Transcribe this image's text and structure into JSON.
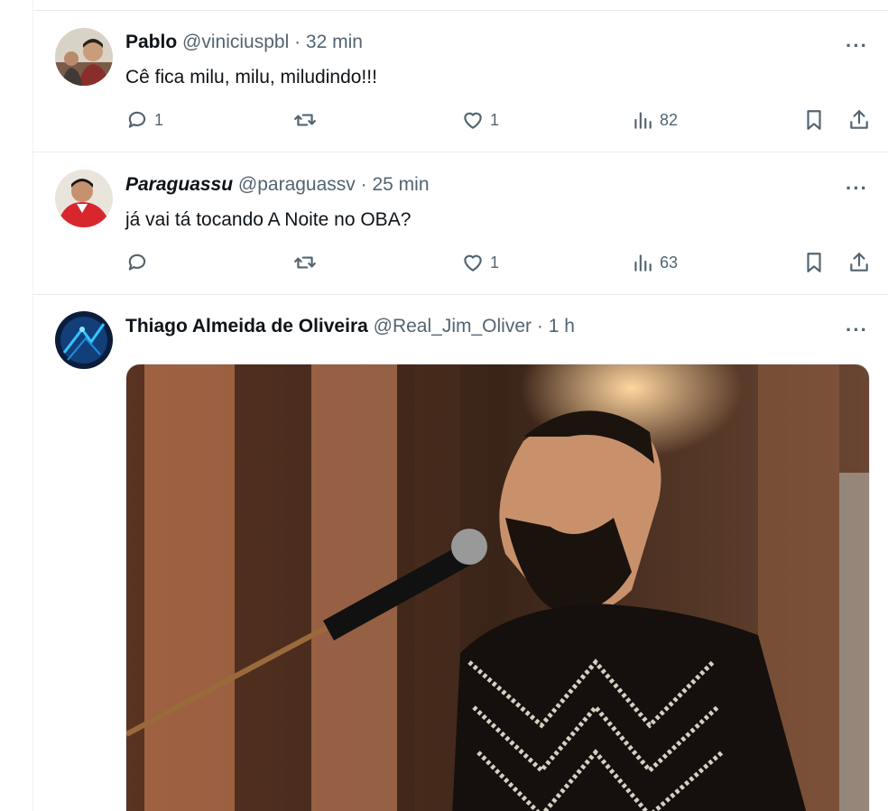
{
  "tweets": [
    {
      "name": "Pablo",
      "handle": "@viniciuspbl",
      "separator": "·",
      "time": "32 min",
      "text": "Cê fica milu, milu, miludindo!!!",
      "more": "···",
      "replies": "1",
      "retweets": "",
      "likes": "1",
      "views": "82"
    },
    {
      "name": "Paraguassu",
      "handle": "@paraguassv",
      "separator": "·",
      "time": "25 min",
      "text": "já vai tá tocando A Noite no OBA?",
      "more": "···",
      "replies": "",
      "retweets": "",
      "likes": "1",
      "views": "63"
    },
    {
      "name": "Thiago Almeida de Oliveira",
      "handle": "@Real_Jim_Oliver",
      "separator": "·",
      "time": "1 h",
      "more": "···"
    }
  ],
  "icons": {
    "reply": "speech-bubble-icon",
    "retweet": "retweet-icon",
    "like": "heart-icon",
    "views": "bar-chart-icon",
    "bookmark": "bookmark-icon",
    "share": "share-upload-icon"
  },
  "colors": {
    "text_primary": "#0f1419",
    "text_secondary": "#536471",
    "divider": "#e7ecee"
  }
}
